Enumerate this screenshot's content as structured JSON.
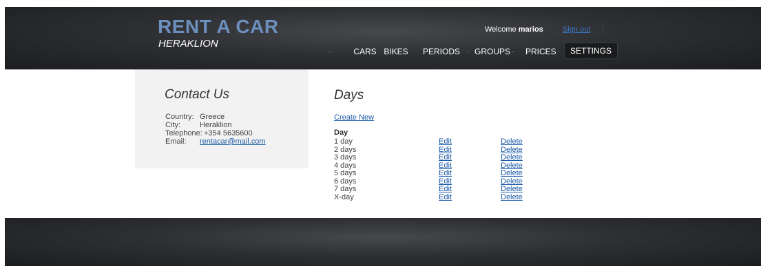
{
  "header": {
    "logo_title": "RENT A CAR",
    "logo_subtitle": "HERAKLION",
    "welcome_prefix": "Welcome ",
    "username": "marios",
    "signout_label": "Sign out",
    "nav": [
      {
        "label": "CARS"
      },
      {
        "label": "BIKES"
      },
      {
        "label": "PERIODS"
      },
      {
        "label": "GROUPS"
      },
      {
        "label": "PRICES"
      },
      {
        "label": "SETTINGS",
        "active": true
      }
    ],
    "colors": {
      "logo": "#6d8fbd",
      "link": "#3c78c8",
      "background": "#2d2f33"
    }
  },
  "sidebar": {
    "title": "Contact Us",
    "contact": [
      {
        "label": "Country:",
        "value": "Greece"
      },
      {
        "label": "City:",
        "value": "Heraklion"
      },
      {
        "label": "Telephone:",
        "value": "+354 5635600"
      },
      {
        "label": "Email:",
        "value": "rentacar@mail.com"
      }
    ]
  },
  "main": {
    "title": "Days",
    "create_new_label": "Create New",
    "column_header": "Day",
    "edit_label": "Edit",
    "delete_label": "Delete",
    "rows": [
      {
        "day": "1 day"
      },
      {
        "day": "2 days"
      },
      {
        "day": "3 days"
      },
      {
        "day": "4 days"
      },
      {
        "day": "5 days"
      },
      {
        "day": "6 days"
      },
      {
        "day": "7 days"
      },
      {
        "day": "X-day"
      }
    ]
  }
}
